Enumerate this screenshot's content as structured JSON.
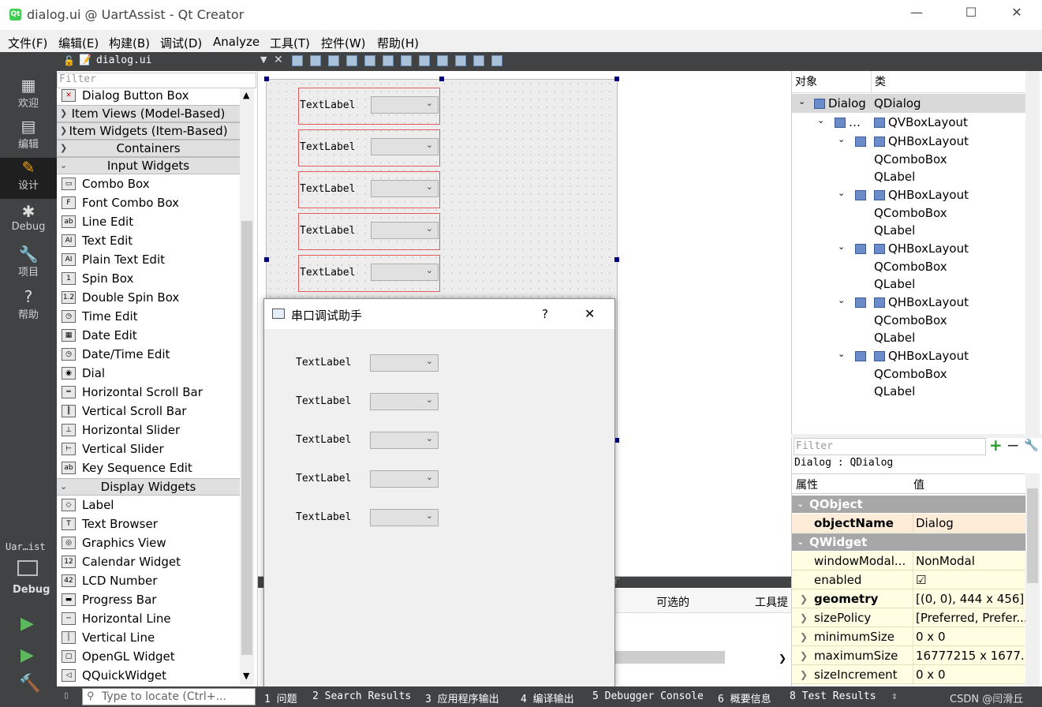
{
  "window": {
    "title": "dialog.ui @ UartAssist - Qt Creator",
    "minimize": "—",
    "maximize": "☐",
    "close": "✕"
  },
  "menu": [
    "文件(F)",
    "编辑(E)",
    "构建(B)",
    "调试(D)",
    "Analyze",
    "工具(T)",
    "控件(W)",
    "帮助(H)"
  ],
  "modes": [
    {
      "label": "欢迎",
      "glyph": "▦"
    },
    {
      "label": "编辑",
      "glyph": "▤"
    },
    {
      "label": "设计",
      "glyph": "✎"
    },
    {
      "label": "Debug",
      "glyph": "✱"
    },
    {
      "label": "项目",
      "glyph": "🔧"
    },
    {
      "label": "帮助",
      "glyph": "?"
    }
  ],
  "kit": {
    "name": "Uar…ist",
    "mode": "Debug"
  },
  "editor": {
    "filename": "dialog.ui"
  },
  "widgetbox": {
    "filter_placeholder": "Filter",
    "top_item": "Dialog Button Box",
    "collapsed": [
      "Item Views (Model-Based)",
      "Item Widgets (Item-Based)",
      "Containers"
    ],
    "input_category": "Input Widgets",
    "input_items": [
      "Combo Box",
      "Font Combo Box",
      "Line Edit",
      "Text Edit",
      "Plain Text Edit",
      "Spin Box",
      "Double Spin Box",
      "Time Edit",
      "Date Edit",
      "Date/Time Edit",
      "Dial",
      "Horizontal Scroll Bar",
      "Vertical Scroll Bar",
      "Horizontal Slider",
      "Vertical Slider",
      "Key Sequence Edit"
    ],
    "display_category": "Display Widgets",
    "display_items": [
      "Label",
      "Text Browser",
      "Graphics View",
      "Calendar Widget",
      "LCD Number",
      "Progress Bar",
      "Horizontal Line",
      "Vertical Line",
      "OpenGL Widget",
      "QQuickWidget"
    ]
  },
  "form": {
    "label": "TextLabel",
    "rows": 5
  },
  "preview": {
    "title": "串口调试助手",
    "help": "?",
    "close": "✕",
    "label": "TextLabel",
    "rows": 5
  },
  "lower": {
    "filter_fragment": "r",
    "col_optional": "可选的",
    "col_tooltip": "工具提"
  },
  "object_inspector": {
    "headers": [
      "对象",
      "类"
    ],
    "root": {
      "name": "Dialog",
      "class": "QDialog"
    },
    "vbox": {
      "name": "…",
      "class": "QVBoxLayout"
    },
    "hbox_class": "QHBoxLayout",
    "combo_class": "QComboBox",
    "label_class": "QLabel"
  },
  "property_editor": {
    "filter_placeholder": "Filter",
    "context": "Dialog : QDialog",
    "headers": [
      "属性",
      "值"
    ],
    "group1": "QObject",
    "group2": "QWidget",
    "rows": [
      {
        "key": "objectName",
        "value": "Dialog"
      },
      {
        "key": "windowModal...",
        "value": "NonModal"
      },
      {
        "key": "enabled",
        "value": "☑"
      },
      {
        "key": "geometry",
        "value": "[(0, 0), 444 x 456]"
      },
      {
        "key": "sizePolicy",
        "value": "[Preferred, Prefer..."
      },
      {
        "key": "minimumSize",
        "value": "0 x 0"
      },
      {
        "key": "maximumSize",
        "value": "16777215 x 1677..."
      },
      {
        "key": "sizeIncrement",
        "value": "0 x 0"
      }
    ]
  },
  "statusbar": {
    "locate_placeholder": "Type to locate (Ctrl+...",
    "tabs": [
      "1 问题",
      "2 Search Results",
      "3 应用程序输出",
      "4 编译输出",
      "5 Debugger Console",
      "6 概要信息",
      "8 Test Results"
    ],
    "watermark": "CSDN @闫滑丘"
  }
}
